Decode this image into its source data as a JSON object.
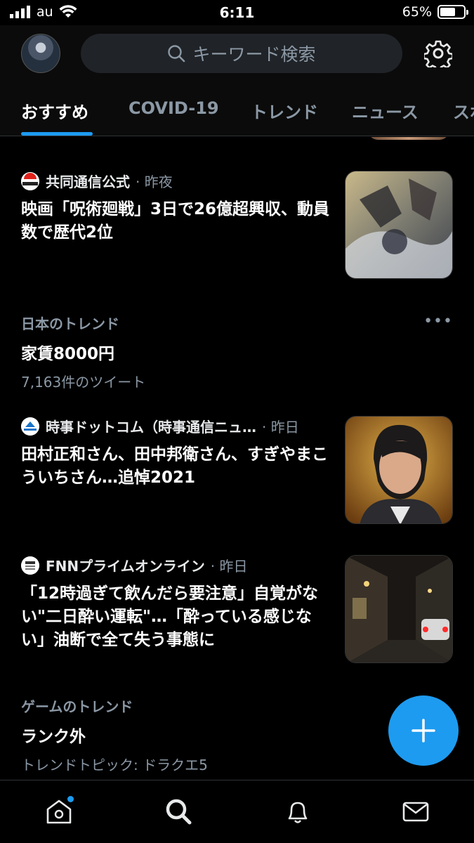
{
  "status_bar": {
    "carrier": "au",
    "time": "6:11",
    "battery_text": "65%",
    "battery_level": 0.65
  },
  "header": {
    "search_placeholder": "キーワード検索",
    "tabs": [
      {
        "label": "おすすめ",
        "active": true
      },
      {
        "label": "COVID-19",
        "active": false
      },
      {
        "label": "トレンド",
        "active": false
      },
      {
        "label": "ニュース",
        "active": false
      },
      {
        "label": "スポ",
        "active": false
      }
    ]
  },
  "feed": [
    {
      "type": "news",
      "source": "共同通信公式",
      "time": "· 昨夜",
      "headline": "映画「呪術廻戦」3日で26億超興収、動員数で歴代2位",
      "logo_text": "KYODO",
      "thumb_icon": "anime-poster-thumbnail"
    },
    {
      "type": "trend",
      "context": "日本のトレンド",
      "name": "家賃8000円",
      "meta": "7,163件のツイート"
    },
    {
      "type": "news",
      "source": "時事ドットコム（時事通信ニュ…",
      "time": "· 昨日",
      "headline": "田村正和さん、田中邦衛さん、すぎやまこういちさん…追悼2021",
      "logo_text": "JIJI.COM",
      "thumb_icon": "portrait-thumbnail"
    },
    {
      "type": "news",
      "source": "FNNプライムオンライン",
      "time": "· 昨日",
      "headline": "「12時過ぎて飲んだら要注意」自覚がない\"二日酔い運転\"…「酔っている感じない」油断で全て失う事態に",
      "logo_text": "FNN",
      "thumb_icon": "night-street-thumbnail"
    },
    {
      "type": "trend",
      "context": "ゲームのトレンド",
      "name": "ランク外",
      "meta": "トレンドトピック: ドラクエ5"
    }
  ],
  "more_label": "•••",
  "bottom_nav": [
    {
      "icon": "home-icon",
      "has_badge": true
    },
    {
      "icon": "search-icon",
      "active": true
    },
    {
      "icon": "bell-icon"
    },
    {
      "icon": "mail-icon"
    }
  ],
  "colors": {
    "accent": "#1d9bf0",
    "background": "#000000",
    "muted_text": "#8b98a5"
  }
}
